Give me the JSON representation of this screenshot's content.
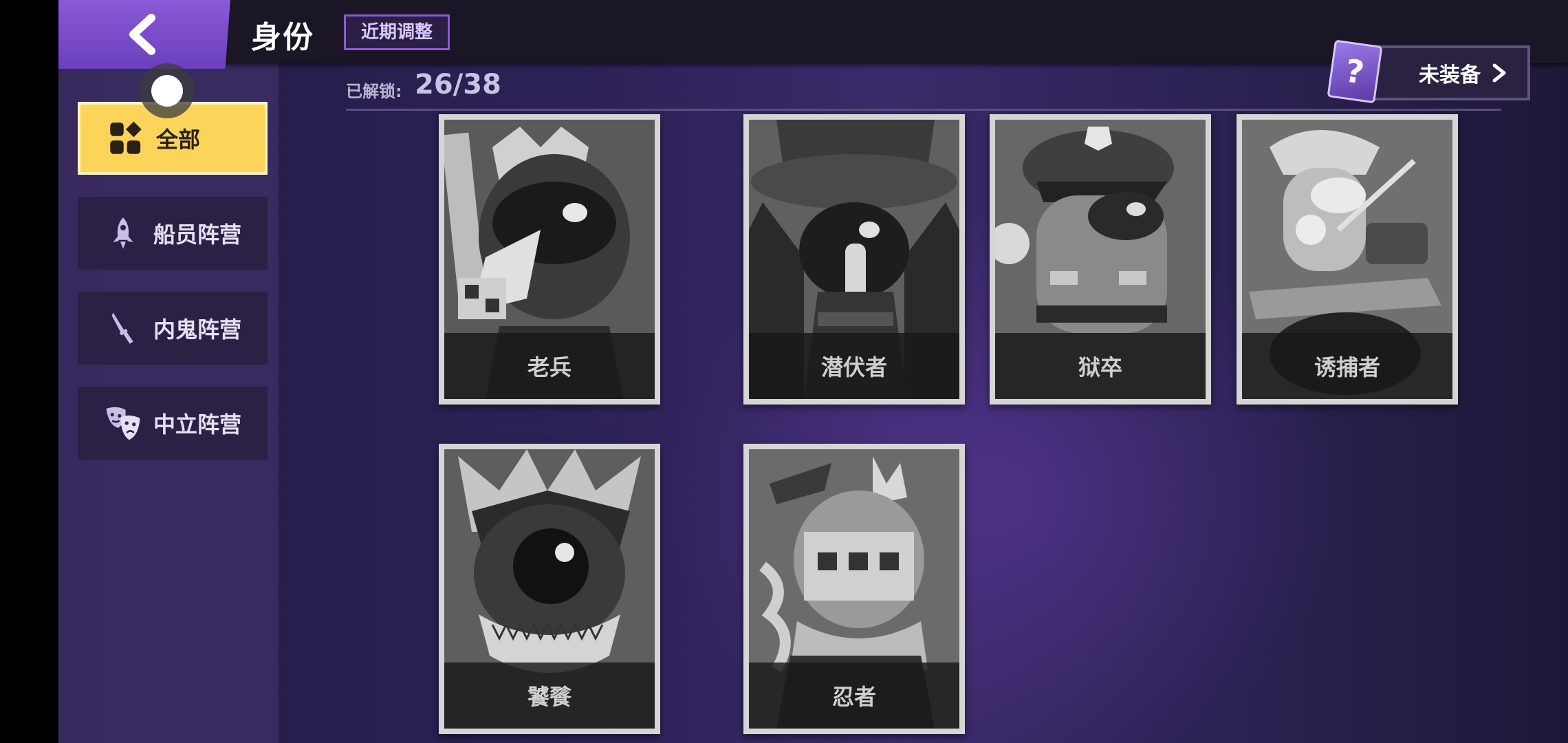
{
  "header": {
    "title": "身份",
    "recent_tag": "近期调整"
  },
  "sidebar": {
    "items": [
      {
        "label": "全部",
        "icon": "grid-icon",
        "active": true
      },
      {
        "label": "船员阵营",
        "icon": "rocket-icon",
        "active": false
      },
      {
        "label": "内鬼阵营",
        "icon": "knife-icon",
        "active": false
      },
      {
        "label": "中立阵营",
        "icon": "theater-masks-icon",
        "active": false
      }
    ]
  },
  "unlocked": {
    "label": "已解锁:",
    "count": "26/38"
  },
  "equip": {
    "card_symbol": "?",
    "label": "未装备"
  },
  "roles": [
    {
      "name": "老兵"
    },
    {
      "name": "潜伏者"
    },
    {
      "name": "狱卒"
    },
    {
      "name": "诱捕者"
    },
    {
      "name": "饕餮"
    },
    {
      "name": "忍者"
    }
  ],
  "colors": {
    "accent_purple": "#8a5ad8",
    "active_yellow": "#fcd45a",
    "sidebar_bg": "#2c2145"
  }
}
